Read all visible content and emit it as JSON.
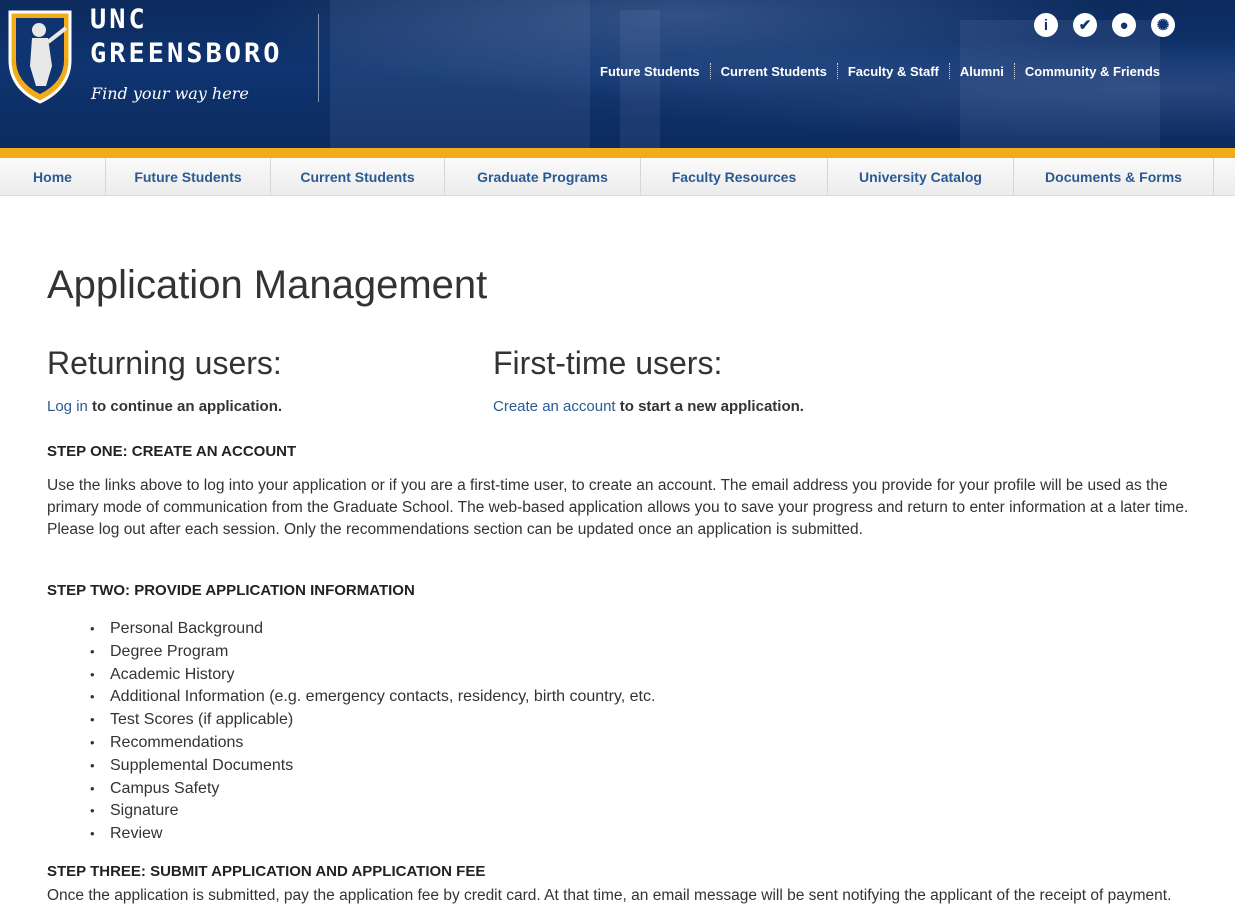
{
  "brand": {
    "line1": "UNC",
    "line2": "GREENSBORO",
    "tagline": "Find your way here"
  },
  "utility_icons": [
    {
      "name": "info-icon",
      "glyph": "i"
    },
    {
      "name": "check-icon",
      "glyph": "✔"
    },
    {
      "name": "user-icon",
      "glyph": "●"
    },
    {
      "name": "compass-icon",
      "glyph": "✺"
    }
  ],
  "audience_nav": [
    "Future Students",
    "Current Students",
    "Faculty & Staff",
    "Alumni",
    "Community & Friends"
  ],
  "section_nav": [
    "Home",
    "Future Students",
    "Current Students",
    "Graduate Programs",
    "Faculty Resources",
    "University Catalog",
    "Documents & Forms"
  ],
  "main": {
    "title": "Application Management",
    "returning": {
      "heading": "Returning users:",
      "link": "Log in",
      "text": " to continue an application."
    },
    "first_time": {
      "heading": "First-time users:",
      "link": "Create an account",
      "text": " to start a new application."
    },
    "step1": {
      "heading": "STEP ONE: CREATE AN ACCOUNT",
      "body": "Use the links above to log into your application or if you are a first-time user, to create an account. The email address you provide for your profile will be used as the primary mode of communication from the Graduate School. The web-based application allows you to save your progress and return to enter information at a later time. Please log out after each session. Only the recommendations section can be updated once an application is submitted."
    },
    "step2": {
      "heading": "STEP TWO: PROVIDE APPLICATION INFORMATION",
      "items": [
        "Personal Background",
        "Degree Program",
        "Academic History",
        "Additional Information (e.g. emergency contacts, residency, birth country, etc.",
        "Test Scores (if applicable)",
        "Recommendations",
        "Supplemental Documents",
        "Campus Safety",
        "Signature",
        "Review"
      ]
    },
    "step3": {
      "heading": "STEP THREE: SUBMIT APPLICATION AND APPLICATION FEE",
      "body": "Once the application is submitted, pay the application fee by credit card. At that time, an email message will be sent notifying the applicant of the receipt of payment."
    }
  },
  "colors": {
    "header_blue": "#0f3470",
    "gold": "#f1ac1b",
    "link_blue": "#2a5a93"
  }
}
